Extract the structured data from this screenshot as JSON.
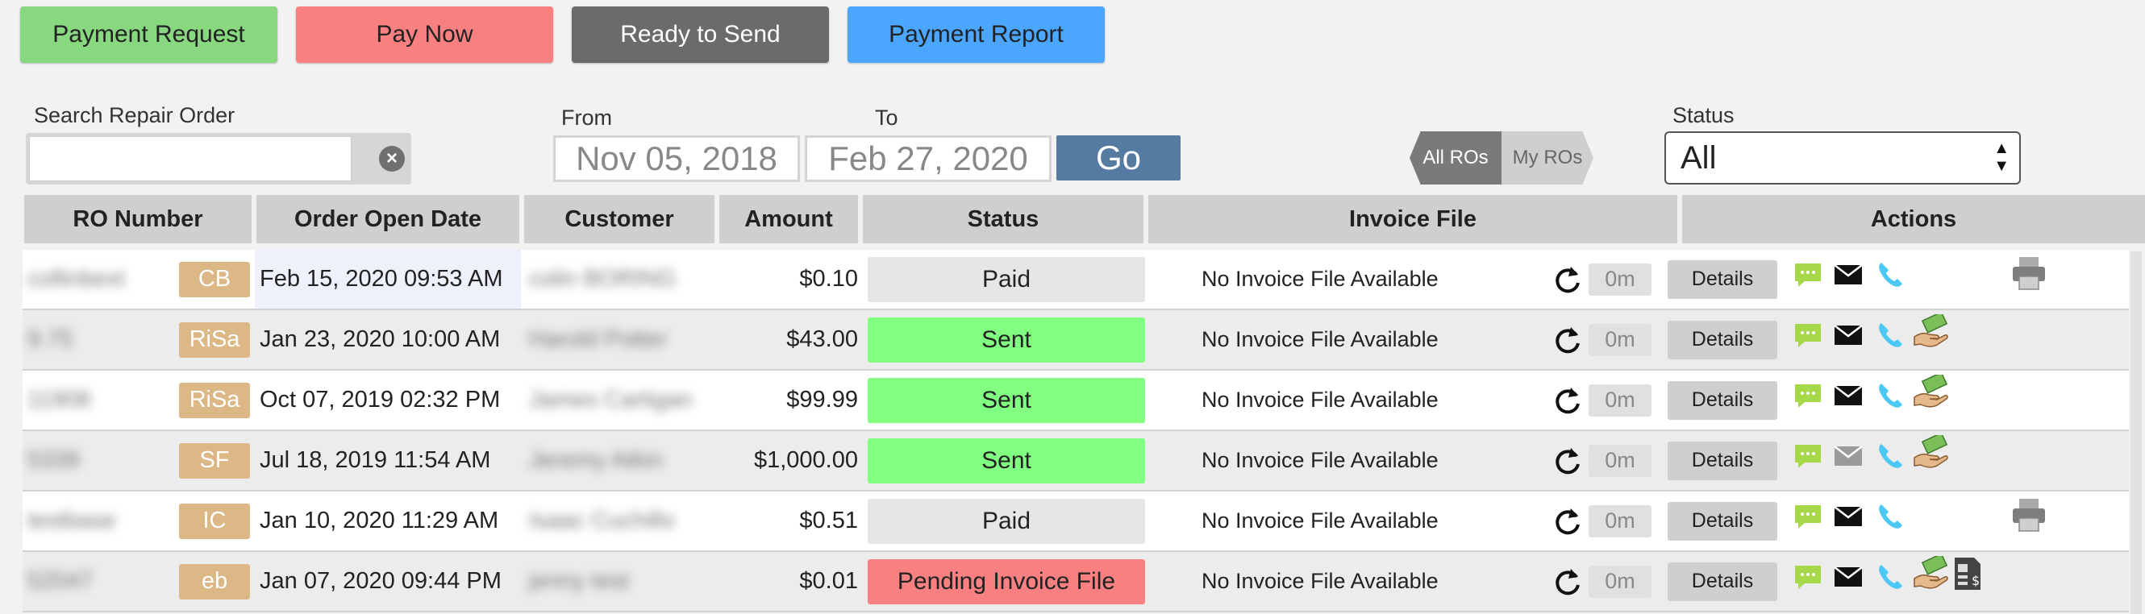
{
  "toolbar": {
    "buttons": [
      {
        "label": "Payment Request",
        "color": "#88d880"
      },
      {
        "label": "Pay Now",
        "color": "#f98080"
      },
      {
        "label": "Ready to Send",
        "color": "#6b6b6b"
      },
      {
        "label": "Payment Report",
        "color": "#4aa6ff"
      }
    ]
  },
  "filters": {
    "search_label": "Search Repair Order",
    "search_value": "",
    "from_label": "From",
    "to_label": "To",
    "from_date": "Nov 05, 2018",
    "to_date": "Feb 27, 2020",
    "go_label": "Go",
    "toggle_all": "All ROs",
    "toggle_mine": "My ROs",
    "status_label": "Status",
    "status_value": "All"
  },
  "table": {
    "headers": [
      "RO Number",
      "Order Open Date",
      "Customer",
      "Amount",
      "Status",
      "Invoice File",
      "Actions"
    ],
    "details_label": "Details",
    "rows": [
      {
        "ro": "collinbext",
        "badge": "CB",
        "date": "Feb 15, 2020 09:53 AM",
        "customer": "colin BORING",
        "amount": "$0.10",
        "status": "Paid",
        "invoice": "No Invoice File Available",
        "minutes": "0m",
        "icons": [
          "chat-icon",
          "mail-icon",
          "phone-icon",
          "print-icon"
        ]
      },
      {
        "ro": "9.75",
        "badge": "RiSa",
        "date": "Jan 23, 2020 10:00 AM",
        "customer": "Harold Potter",
        "amount": "$43.00",
        "status": "Sent",
        "invoice": "No Invoice File Available",
        "minutes": "0m",
        "icons": [
          "chat-icon",
          "mail-icon",
          "phone-icon",
          "payment-hand-icon"
        ]
      },
      {
        "ro": "11908",
        "badge": "RiSa",
        "date": "Oct 07, 2019 02:32 PM",
        "customer": "James Cartigan",
        "amount": "$99.99",
        "status": "Sent",
        "invoice": "No Invoice File Available",
        "minutes": "0m",
        "icons": [
          "chat-icon",
          "mail-icon",
          "phone-icon",
          "payment-hand-icon"
        ]
      },
      {
        "ro": "5339",
        "badge": "SF",
        "date": "Jul 18, 2019 11:54 AM",
        "customer": "Jeremy Atkin",
        "amount": "$1,000.00",
        "status": "Sent",
        "invoice": "No Invoice File Available",
        "minutes": "0m",
        "icons": [
          "chat-icon",
          "mail-icon",
          "phone-icon",
          "payment-hand-icon"
        ]
      },
      {
        "ro": "testbase",
        "badge": "IC",
        "date": "Jan 10, 2020 11:29 AM",
        "customer": "Isaac Cuchillo",
        "amount": "$0.51",
        "status": "Paid",
        "invoice": "No Invoice File Available",
        "minutes": "0m",
        "icons": [
          "chat-icon",
          "mail-icon",
          "phone-icon",
          "print-icon"
        ]
      },
      {
        "ro": "52047",
        "badge": "eb",
        "date": "Jan 07, 2020 09:44 PM",
        "customer": "jenny test",
        "amount": "$0.01",
        "status": "Pending Invoice File",
        "invoice": "No Invoice File Available",
        "minutes": "0m",
        "icons": [
          "chat-icon",
          "mail-icon",
          "phone-icon",
          "payment-hand-icon",
          "invoice-doc-icon"
        ]
      }
    ]
  },
  "colors": {
    "paid": "#e6e6e6",
    "sent": "#80ff80",
    "pending": "#f98080",
    "badge": "#ddb887",
    "chat": "#a7d84a",
    "phone": "#4cc8f4"
  }
}
